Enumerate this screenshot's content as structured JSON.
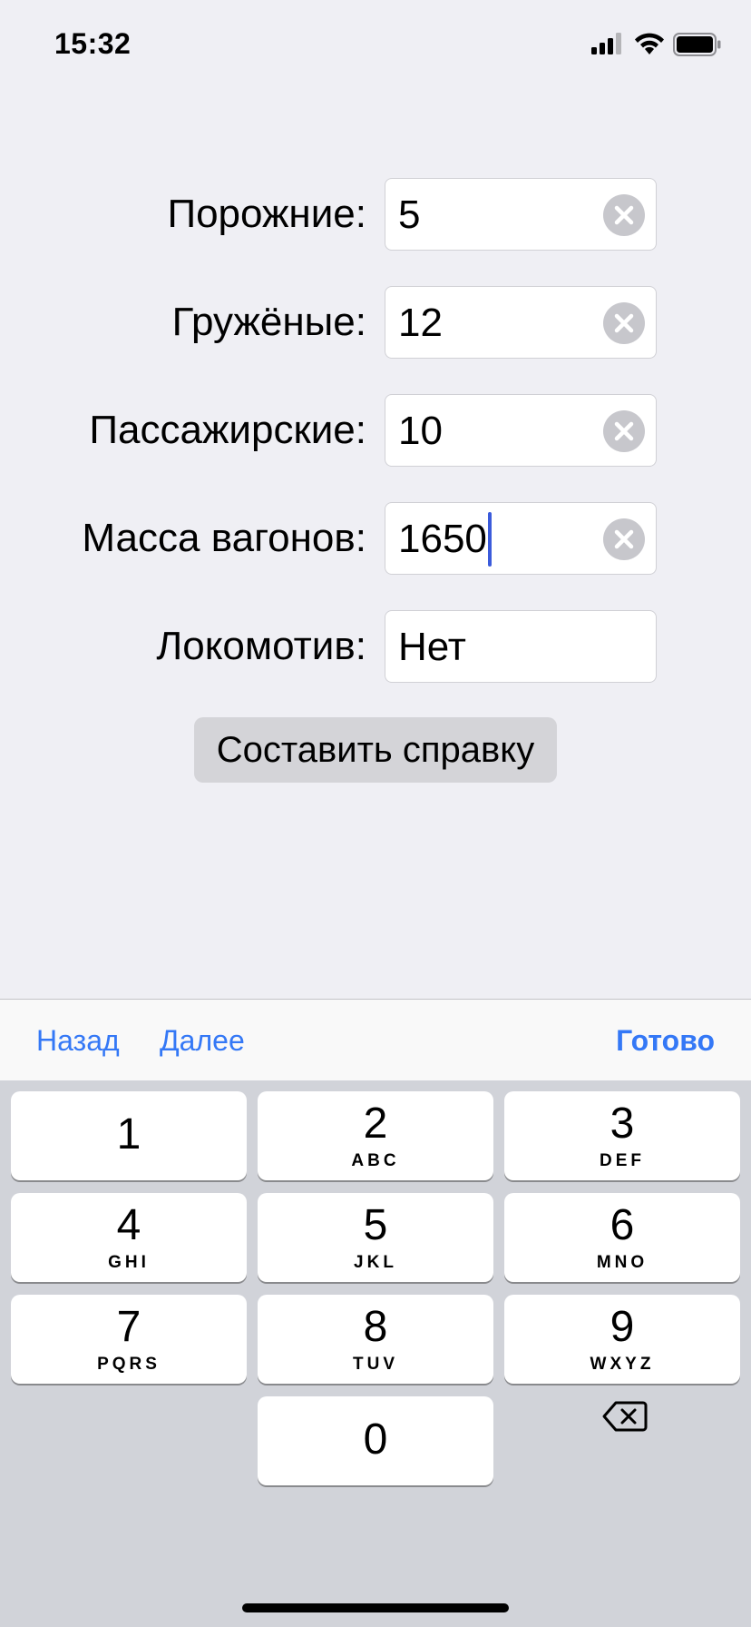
{
  "status_bar": {
    "time": "15:32"
  },
  "form": {
    "fields": [
      {
        "label": "Порожние:",
        "value": "5"
      },
      {
        "label": "Гружёные:",
        "value": "12"
      },
      {
        "label": "Пассажирские:",
        "value": "10"
      },
      {
        "label": "Масса вагонов:",
        "value": "1650"
      },
      {
        "label": "Локомотив:",
        "value": "Нет"
      }
    ],
    "submit_label": "Составить справку"
  },
  "accessory_bar": {
    "back_label": "Назад",
    "next_label": "Далее",
    "done_label": "Готово"
  },
  "keyboard": {
    "keys": [
      {
        "digit": "1",
        "letters": ""
      },
      {
        "digit": "2",
        "letters": "ABC"
      },
      {
        "digit": "3",
        "letters": "DEF"
      },
      {
        "digit": "4",
        "letters": "GHI"
      },
      {
        "digit": "5",
        "letters": "JKL"
      },
      {
        "digit": "6",
        "letters": "MNO"
      },
      {
        "digit": "7",
        "letters": "PQRS"
      },
      {
        "digit": "8",
        "letters": "TUV"
      },
      {
        "digit": "9",
        "letters": "WXYZ"
      },
      {
        "digit": "0",
        "letters": ""
      }
    ],
    "delete_icon": "backspace-icon"
  },
  "colors": {
    "accent": "#3478f6",
    "background": "#efeff4",
    "keyboard": "#d1d3d9",
    "caret": "#3b5bdb"
  }
}
